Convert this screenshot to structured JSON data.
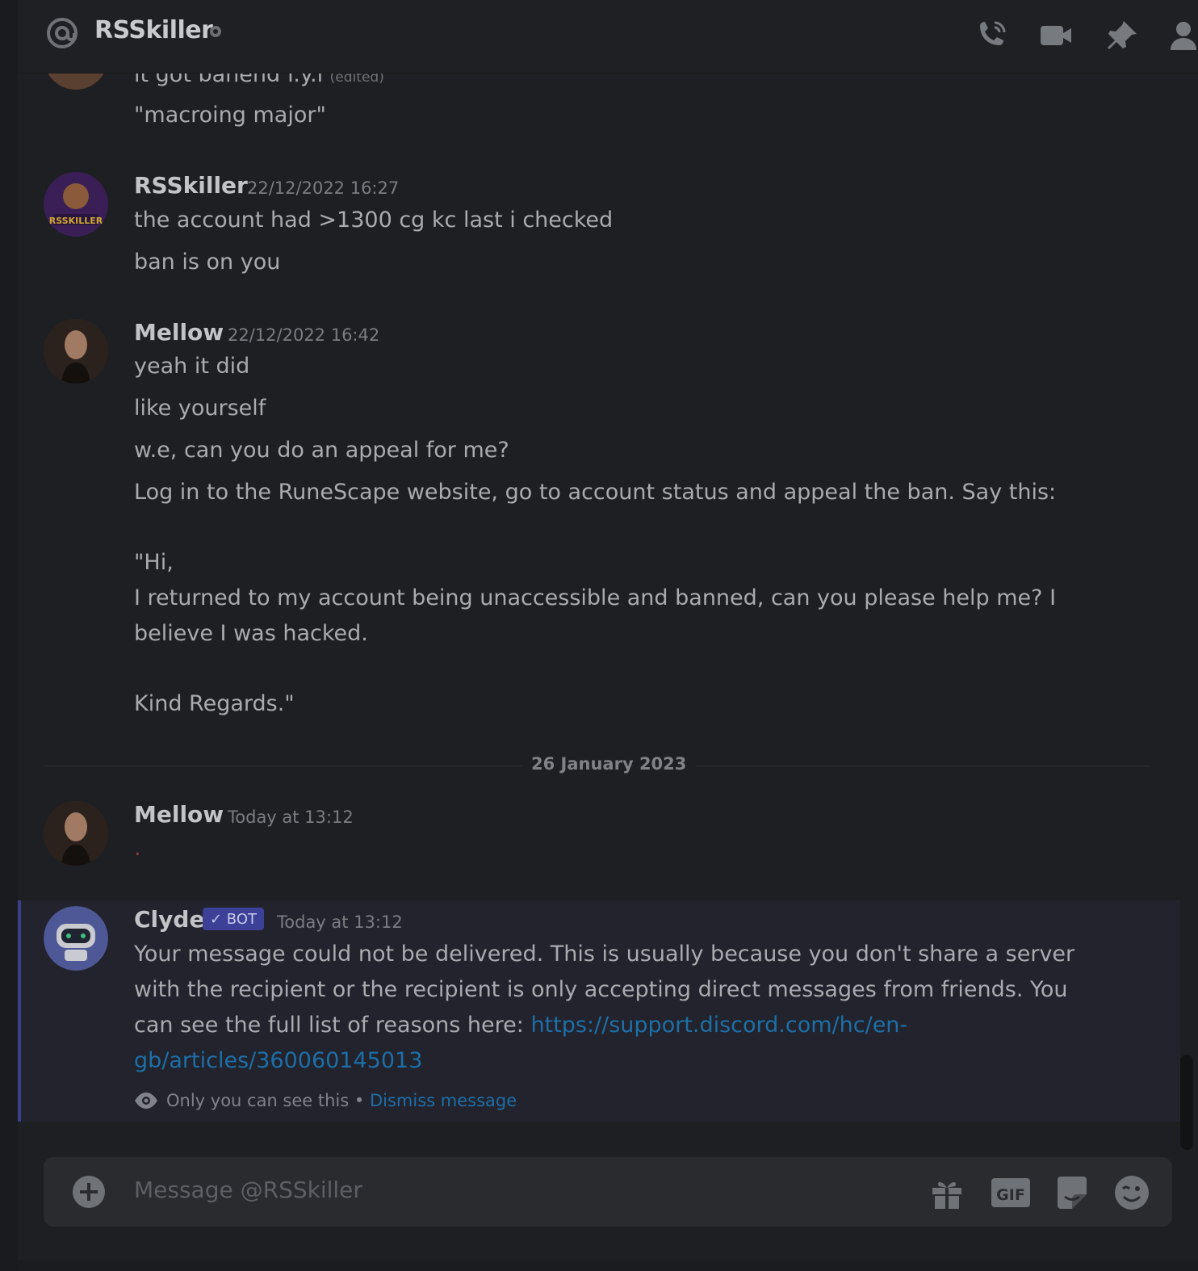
{
  "header": {
    "title": "RSSkiller",
    "icons": [
      "at-icon",
      "status-dot",
      "voice-call-icon",
      "video-call-icon",
      "pin-icon",
      "member-list-icon"
    ]
  },
  "messages": [
    {
      "lines": [
        {
          "text": "it got banend f.y.i",
          "edited": "(edited)"
        },
        {
          "text": "\"macroing major\""
        }
      ]
    },
    {
      "author": "RSSkiller",
      "timestamp": "22/12/2022 16:27",
      "avatar_text": "RSSKILLER",
      "lines": [
        "the account had >1300 cg kc last i checked",
        "ban is on you"
      ]
    },
    {
      "author": "Mellow",
      "timestamp": "22/12/2022 16:42",
      "lines": [
        "yeah it did",
        "like yourself",
        "w.e, can you do an appeal for me?",
        "Log in to the RuneScape website, go to account status and appeal the ban. Say this:",
        "\"Hi,",
        "I returned to my account being unaccessible and banned, can you please help me? I",
        "believe I was hacked.",
        "Kind Regards.\""
      ]
    },
    {
      "author": "Mellow",
      "timestamp": "Today at 13:12",
      "lines": [
        "."
      ]
    },
    {
      "author": "Clyde",
      "badge": "BOT",
      "timestamp": "Today at 13:12",
      "lines": [
        "Your message could not be delivered. This is usually because you don't share a server",
        "with the recipient or the recipient is only accepting direct messages from friends. You",
        "can see the full list of reasons here: "
      ],
      "link_part1": "https://support.discord.com/hc/en-",
      "link_part2": "gb/articles/360060145013",
      "notice": "Only you can see this •",
      "dismiss": "Dismiss message"
    }
  ],
  "date_divider": "26 January 2023",
  "composer": {
    "placeholder": "Message @RSSkiller",
    "icons": [
      "add-attachment-icon",
      "gift-icon",
      "gif-icon",
      "sticker-icon",
      "emoji-icon"
    ]
  },
  "colors": {
    "background": "#1e1f22",
    "link": "#1d6fa8",
    "bot_badge": "#3c4096",
    "system_highlight": "#22232c"
  }
}
